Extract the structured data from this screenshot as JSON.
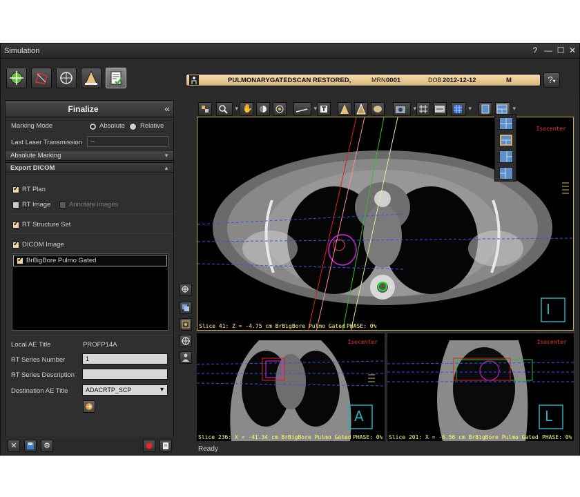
{
  "window": {
    "title": "Simulation",
    "controls": {
      "help": "?",
      "minimize": "—",
      "maximize": "☐",
      "close": "✕"
    }
  },
  "patient_bar": {
    "name": "PULMONARYGATEDSCAN RESTORED,",
    "mrn_label": "MRN",
    "mrn": "0001",
    "dob_label": "DOB",
    "dob": "2012-12-12",
    "sex": "M"
  },
  "help_button": "?",
  "panel": {
    "title": "Finalize",
    "collapse_icon": "«",
    "marking_mode_label": "Marking Mode",
    "marking_mode_options": [
      "Absolute",
      "Relative"
    ],
    "marking_mode_selected": "Absolute",
    "last_laser_label": "Last Laser Transmission",
    "last_laser_value": "--",
    "absolute_marking_section": "Absolute Marking",
    "export_dicom_section": "Export DICOM",
    "rt_plan_label": "RT Plan",
    "rt_plan_checked": true,
    "rt_image_label": "RT Image",
    "rt_image_checked": false,
    "annotate_images_label": "Annotate images",
    "annotate_images_checked": false,
    "rt_structure_label": "RT Structure Set",
    "rt_structure_checked": true,
    "dicom_image_label": "DICOM Image",
    "dicom_image_checked": true,
    "image_list": [
      {
        "label": "BrBigBore Pulmo Gated",
        "checked": true
      }
    ],
    "local_ae_label": "Local AE Title",
    "local_ae_value": "PROFP14A",
    "rt_series_number_label": "RT Series Number",
    "rt_series_number_value": "1",
    "rt_series_desc_label": "RT Series Description",
    "rt_series_desc_value": "",
    "dest_ae_label": "Destination AE Title",
    "dest_ae_value": "ADACRTP_SCP"
  },
  "viewports": {
    "axial": {
      "isocenter": "Isocenter",
      "caption": "Slice 41: Z = -4.75 cm BrBigBore Pulmo Gated",
      "phase": "PHASE: 0%",
      "orientation_letter": "I"
    },
    "coronal": {
      "isocenter": "Isocenter",
      "caption": "Slice 236: X = -41.34 cm BrBigBore Pulmo Gated",
      "phase": "PHASE: 0%",
      "orientation_letter": "A"
    },
    "sagittal": {
      "isocenter": "Isocenter",
      "caption": "Slice 201: X = -6.56 cm BrBigBore Pulmo Gated",
      "phase": "PHASE: 0%",
      "orientation_letter": "L"
    }
  },
  "status": "Ready",
  "colors": {
    "patient_bar": "#e9c98e",
    "selected_layout": "#d9b56d",
    "layout_icon": "#5e8fc9",
    "overlay_text": "#ffff66",
    "isocenter_text": "#ff3030"
  }
}
